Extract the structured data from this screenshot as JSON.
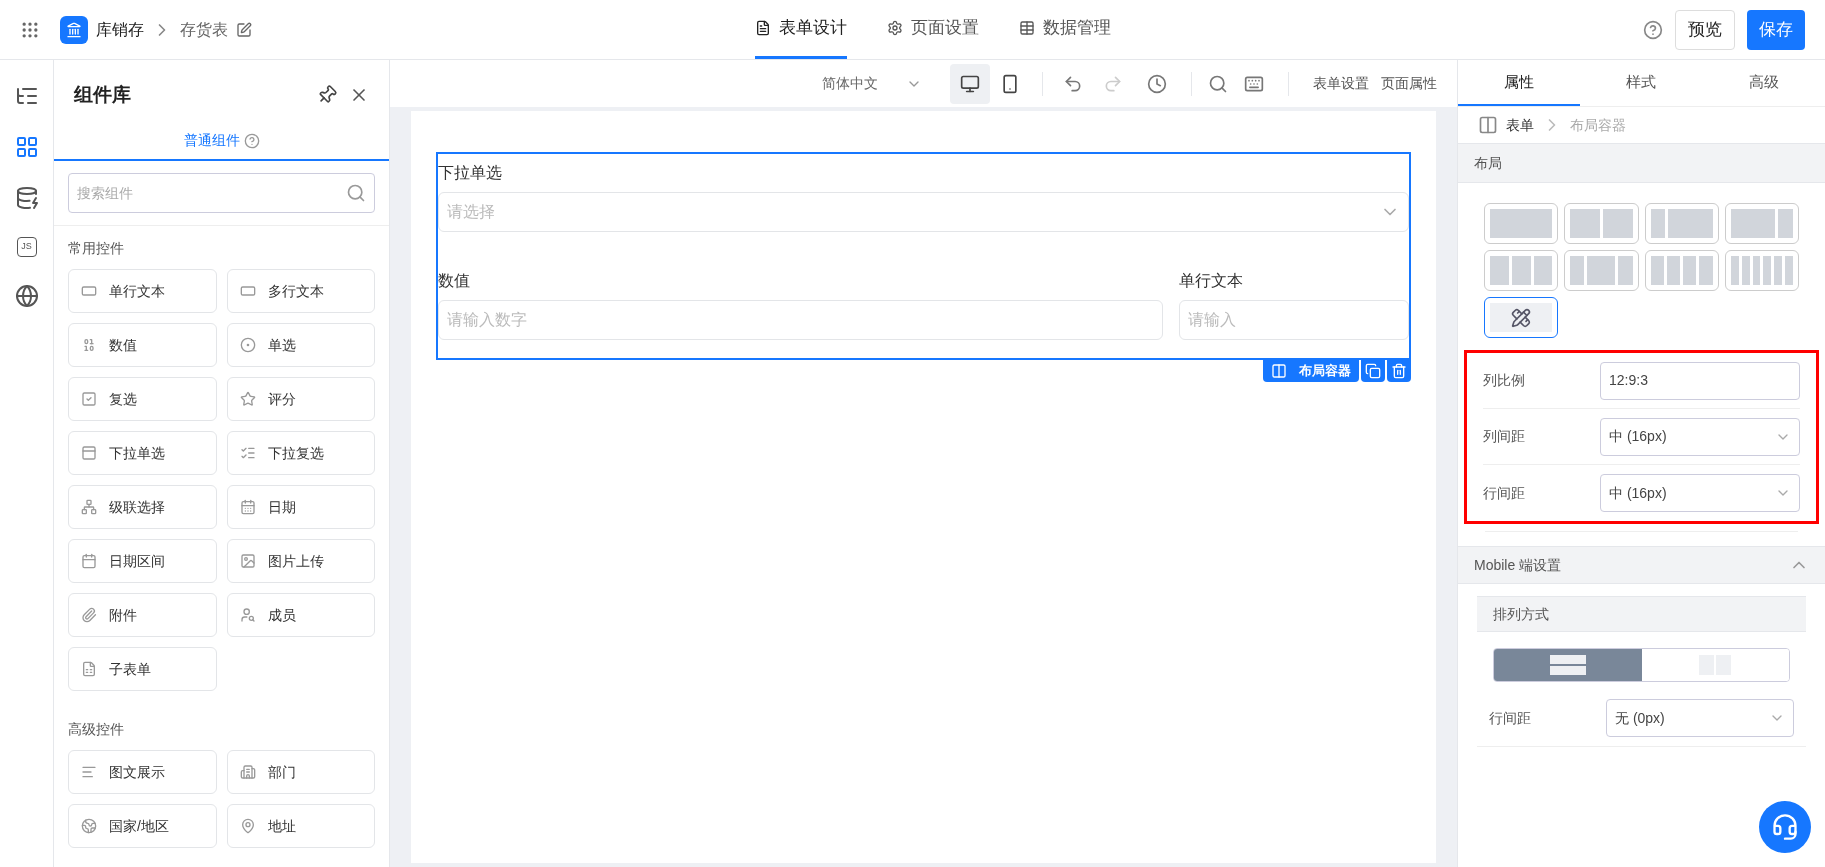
{
  "header": {
    "app_name": "库销存",
    "page_name": "存货表",
    "tabs": [
      {
        "label": "表单设计",
        "kind": "form",
        "selected": true
      },
      {
        "label": "页面设置",
        "kind": "settings",
        "selected": false
      },
      {
        "label": "数据管理",
        "kind": "table",
        "selected": false
      }
    ],
    "buttons": [
      {
        "label": "预览",
        "kind": "secondary"
      },
      {
        "label": "保存",
        "kind": "primary"
      }
    ]
  },
  "rail": [
    {
      "kind": "outline",
      "selected": false
    },
    {
      "kind": "components",
      "selected": true
    },
    {
      "kind": "datasource",
      "selected": false
    },
    {
      "kind": "js",
      "label": "JS",
      "selected": false
    },
    {
      "kind": "i18n",
      "selected": false
    }
  ],
  "library": {
    "title": "组件库",
    "tab": "普通组件",
    "search": {
      "placeholder": "搜索组件"
    },
    "sections": [
      {
        "title": "常用控件",
        "items": [
          {
            "label": "单行文本",
            "kind": "input"
          },
          {
            "label": "多行文本",
            "kind": "textarea"
          },
          {
            "label": "数值",
            "kind": "number"
          },
          {
            "label": "单选",
            "kind": "radio"
          },
          {
            "label": "复选",
            "kind": "checkbox"
          },
          {
            "label": "评分",
            "kind": "rating"
          },
          {
            "label": "下拉单选",
            "kind": "select"
          },
          {
            "label": "下拉复选",
            "kind": "multiselect"
          },
          {
            "label": "级联选择",
            "kind": "cascader"
          },
          {
            "label": "日期",
            "kind": "date"
          },
          {
            "label": "日期区间",
            "kind": "daterange"
          },
          {
            "label": "图片上传",
            "kind": "image"
          },
          {
            "label": "附件",
            "kind": "attachment"
          },
          {
            "label": "成员",
            "kind": "member"
          },
          {
            "label": "子表单",
            "kind": "subform"
          }
        ]
      },
      {
        "title": "高级控件",
        "items": [
          {
            "label": "图文展示",
            "kind": "richtext"
          },
          {
            "label": "部门",
            "kind": "department"
          },
          {
            "label": "国家/地区",
            "kind": "region"
          },
          {
            "label": "地址",
            "kind": "address"
          }
        ]
      }
    ]
  },
  "toolbar": {
    "language": "简体中文",
    "devices": [
      {
        "kind": "desktop",
        "selected": true
      },
      {
        "kind": "mobile",
        "selected": false
      }
    ],
    "undo_disabled": false,
    "redo_disabled": true,
    "links": [
      "表单设置",
      "页面属性"
    ]
  },
  "canvas": {
    "rows": [
      [
        {
          "label": "下拉单选",
          "placeholder": "请选择",
          "kind": "select"
        }
      ],
      [
        {
          "label": "数值",
          "placeholder": "请输入数字",
          "kind": "input"
        },
        {
          "label": "单行文本",
          "placeholder": "请输入",
          "kind": "input"
        }
      ]
    ],
    "container_label": "布局容器"
  },
  "properties": {
    "tabs": [
      {
        "label": "属性",
        "selected": true
      },
      {
        "label": "样式",
        "selected": false
      },
      {
        "label": "高级",
        "selected": false
      }
    ],
    "breadcrumb": [
      "表单",
      "布局容器"
    ],
    "layout_title": "布局",
    "layouts": [
      {
        "selected": false
      },
      {
        "selected": false
      },
      {
        "selected": false
      },
      {
        "selected": false
      },
      {
        "selected": false
      },
      {
        "selected": false
      },
      {
        "selected": false
      },
      {
        "selected": false
      },
      {
        "selected": true
      }
    ],
    "fields": [
      {
        "label": "列比例",
        "value": "12:9:3",
        "kind": "text"
      },
      {
        "label": "列间距",
        "value": "中 (16px)",
        "kind": "select"
      },
      {
        "label": "行间距",
        "value": "中 (16px)",
        "kind": "select"
      }
    ],
    "mobile": {
      "title": "Mobile 端设置",
      "expanded": true,
      "arrange_title": "排列方式",
      "arrange": [
        {
          "kind": "stack",
          "selected": true
        },
        {
          "kind": "columns",
          "selected": false
        }
      ],
      "fields": [
        {
          "label": "行间距",
          "value": "无 (0px)",
          "kind": "select"
        }
      ]
    }
  }
}
